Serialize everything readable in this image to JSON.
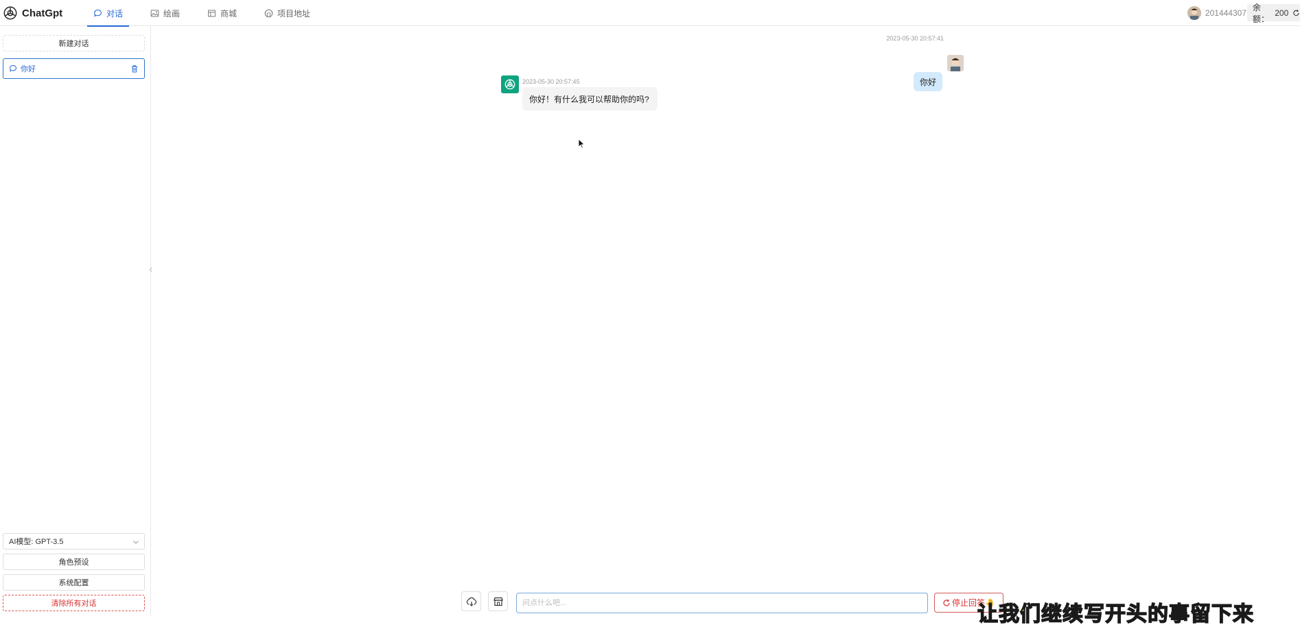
{
  "app": {
    "name": "ChatGpt"
  },
  "nav": {
    "items": [
      {
        "label": "对话",
        "icon": "chat-icon",
        "active": true
      },
      {
        "label": "绘画",
        "icon": "image-icon",
        "active": false
      },
      {
        "label": "商城",
        "icon": "store-icon",
        "active": false
      },
      {
        "label": "项目地址",
        "icon": "github-icon",
        "active": false
      }
    ]
  },
  "user": {
    "id": "201444307",
    "balance_label": "余额：",
    "balance_value": "200"
  },
  "sidebar": {
    "new_chat_label": "新建对话",
    "conversations": [
      {
        "title": "你好",
        "selected": true
      }
    ],
    "model_label": "AI模型: GPT-3.5",
    "role_preset_label": "角色预设",
    "system_config_label": "系统配置",
    "clear_all_label": "清除所有对话"
  },
  "messages": [
    {
      "role": "user",
      "time": "2023-05-30 20:57:41",
      "text": "你好"
    },
    {
      "role": "assistant",
      "time": "2023-05-30 20:57:45",
      "text": "你好！有什么我可以帮助你的吗?"
    }
  ],
  "composer": {
    "placeholder": "问点什么吧...",
    "stop_label": "停止回答",
    "stop_emoji": "🤚"
  },
  "overlay": {
    "subtitle": "让我们继续写开头的事留下来"
  },
  "colors": {
    "accent": "#2468d6",
    "danger": "#d93030",
    "user_bubble": "#d2eafc",
    "bot_avatar": "#10a37f"
  }
}
